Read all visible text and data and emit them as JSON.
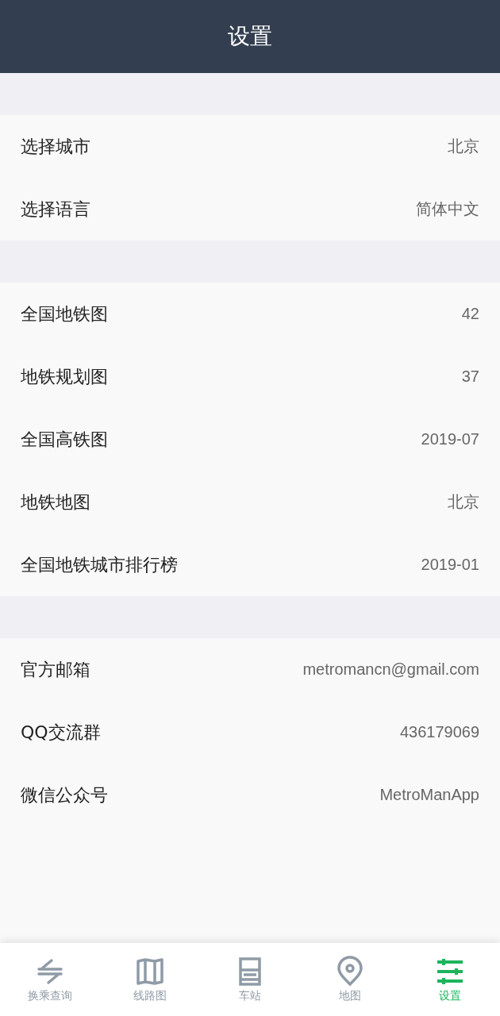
{
  "header": {
    "title": "设置"
  },
  "sections": [
    {
      "rows": [
        {
          "label": "选择城市",
          "value": "北京"
        },
        {
          "label": "选择语言",
          "value": "简体中文"
        }
      ]
    },
    {
      "rows": [
        {
          "label": "全国地铁图",
          "value": "42"
        },
        {
          "label": "地铁规划图",
          "value": "37"
        },
        {
          "label": "全国高铁图",
          "value": "2019-07"
        },
        {
          "label": "地铁地图",
          "value": "北京"
        },
        {
          "label": "全国地铁城市排行榜",
          "value": "2019-01"
        }
      ]
    },
    {
      "rows": [
        {
          "label": "官方邮箱",
          "value": "metromancn@gmail.com"
        },
        {
          "label": "QQ交流群",
          "value": "436179069"
        },
        {
          "label": "微信公众号",
          "value": "MetroManApp"
        }
      ]
    }
  ],
  "tabs": [
    {
      "kind": "transfer",
      "label": "换乘查询",
      "selected": false
    },
    {
      "kind": "lines",
      "label": "线路图",
      "selected": false
    },
    {
      "kind": "station",
      "label": "车站",
      "selected": false
    },
    {
      "kind": "map",
      "label": "地图",
      "selected": false
    },
    {
      "kind": "settings",
      "label": "设置",
      "selected": true
    }
  ]
}
